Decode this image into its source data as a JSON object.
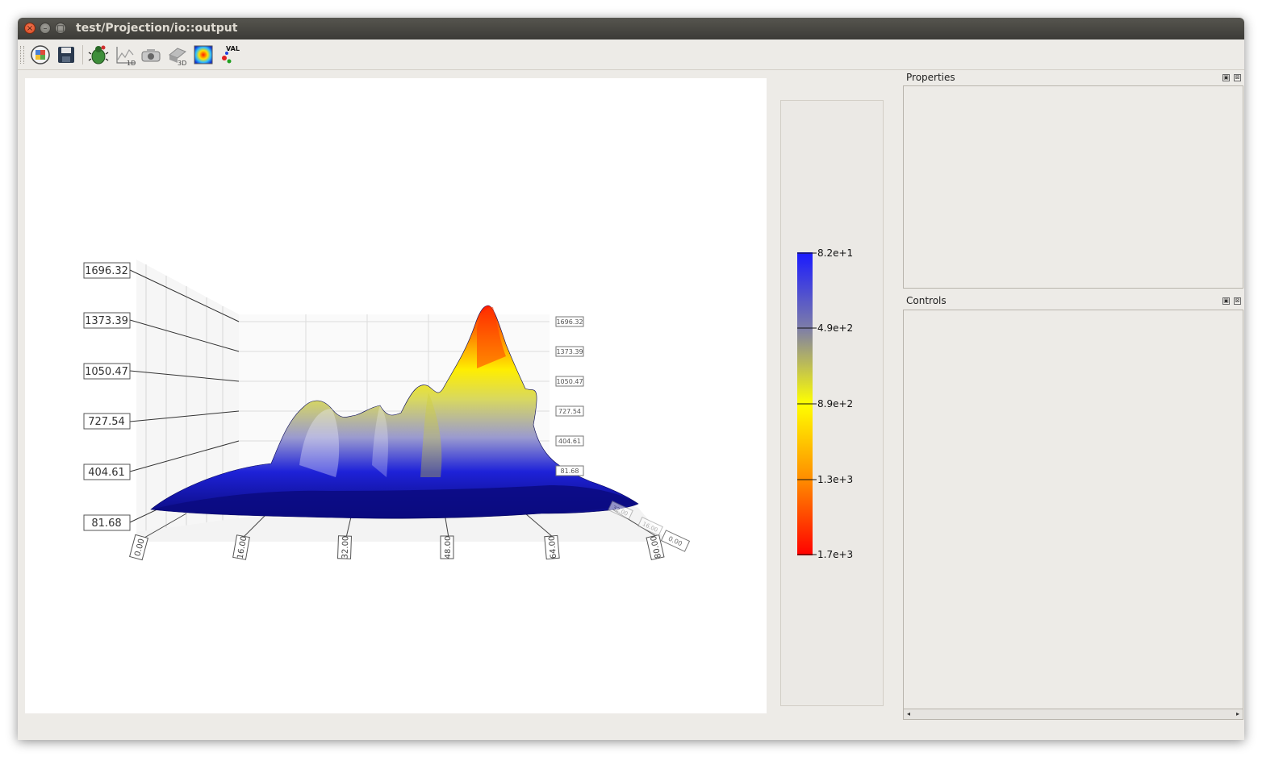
{
  "window": {
    "title": "test/Projection/io::output",
    "buttons": {
      "close": "×",
      "minimize": "–",
      "maximize": "□"
    }
  },
  "toolbar": {
    "icons": [
      "reset-view-icon",
      "save-icon",
      "debug-bug-icon",
      "plot-1d-icon",
      "camera-icon",
      "view-3d-icon",
      "heatmap-icon",
      "values-icon"
    ],
    "labels": {
      "plot1d": "1D",
      "view3d": "3D",
      "values": "VAL UES"
    }
  },
  "plot": {
    "z_ticks": [
      "1696.32",
      "1373.39",
      "1050.47",
      "727.54",
      "404.61",
      "81.68"
    ],
    "x_ticks": [
      "0.00",
      "16.00",
      "32.00",
      "48.00",
      "64.00",
      "80.00"
    ],
    "depth_ticks": [
      "32.00",
      "16.00",
      "0.00"
    ]
  },
  "colorbar": {
    "labels": [
      "8.2e+1",
      "4.9e+2",
      "8.9e+2",
      "1.3e+3",
      "1.7e+3"
    ],
    "colors": [
      "#1a1aff",
      "#7d7da8",
      "#ffff00",
      "#ff8c00",
      "#ff0000"
    ]
  },
  "docks": {
    "properties": {
      "title": "Properties"
    },
    "controls": {
      "title": "Controls"
    },
    "float_glyph": "▣",
    "close_glyph": "⊠"
  },
  "scrollbar": {
    "left_arrow": "◂",
    "right_arrow": "▸"
  }
}
